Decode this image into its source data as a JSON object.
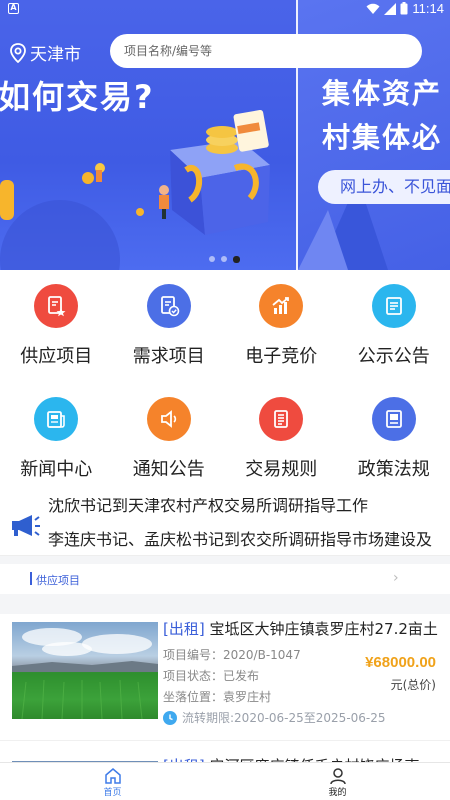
{
  "status_bar": {
    "time": "11:14",
    "left_icon": "A"
  },
  "header": {
    "location": "天津市",
    "search_placeholder": "项目名称/编号等"
  },
  "banner": {
    "slide1_headline": "如何交易?",
    "slide2_line1": "集体资产",
    "slide2_line2": "村集体必",
    "slide2_pill": "网上办、不见面",
    "dot_count": 3,
    "active_dot": 3
  },
  "categories": [
    {
      "label": "供应项目",
      "icon": "doc-star-icon",
      "color": "#ef4b3f"
    },
    {
      "label": "需求项目",
      "icon": "doc-check-icon",
      "color": "#4c6fe6"
    },
    {
      "label": "电子竞价",
      "icon": "chart-up-icon",
      "color": "#f5832b"
    },
    {
      "label": "公示公告",
      "icon": "doc-list-icon",
      "color": "#2bb6ee"
    },
    {
      "label": "新闻中心",
      "icon": "news-icon",
      "color": "#2bb6ee"
    },
    {
      "label": "通知公告",
      "icon": "speaker-icon",
      "color": "#f5832b"
    },
    {
      "label": "交易规则",
      "icon": "rules-icon",
      "color": "#ef4b3f"
    },
    {
      "label": "政策法规",
      "icon": "policy-book-icon",
      "color": "#4c6fe6"
    }
  ],
  "ticker": {
    "line1": "沈欣书记到天津农村产权交易所调研指导工作",
    "line2": "李连庆书记、孟庆松书记到农交所调研指导市场建设及"
  },
  "section": {
    "title": "供应项目",
    "more": "›"
  },
  "listing": {
    "tag": "[出租]",
    "title": "宝坻区大钟庄镇袁罗庄村27.2亩土",
    "number_label": "项目编号：",
    "number": "2020/B-1047",
    "status_label": "项目状态：",
    "status": "已发布",
    "location_label": "坐落位置：",
    "location": "袁罗庄村",
    "price": "¥68000.00",
    "price_unit": "元(总价)",
    "period": "流转期限:2020-06-25至2025-06-25"
  },
  "listing2": {
    "tag": "[出租]",
    "title": "宁河区廉庄镇任千户村饶庄场夷"
  },
  "bottom_nav": [
    {
      "label": "首页",
      "icon": "home-icon",
      "active": true
    },
    {
      "label": "我的",
      "icon": "user-icon",
      "active": false
    }
  ],
  "colors": {
    "brand_blue": "#3f5be4",
    "accent_orange": "#f0a21a",
    "active_nav": "#3f7ce8"
  }
}
